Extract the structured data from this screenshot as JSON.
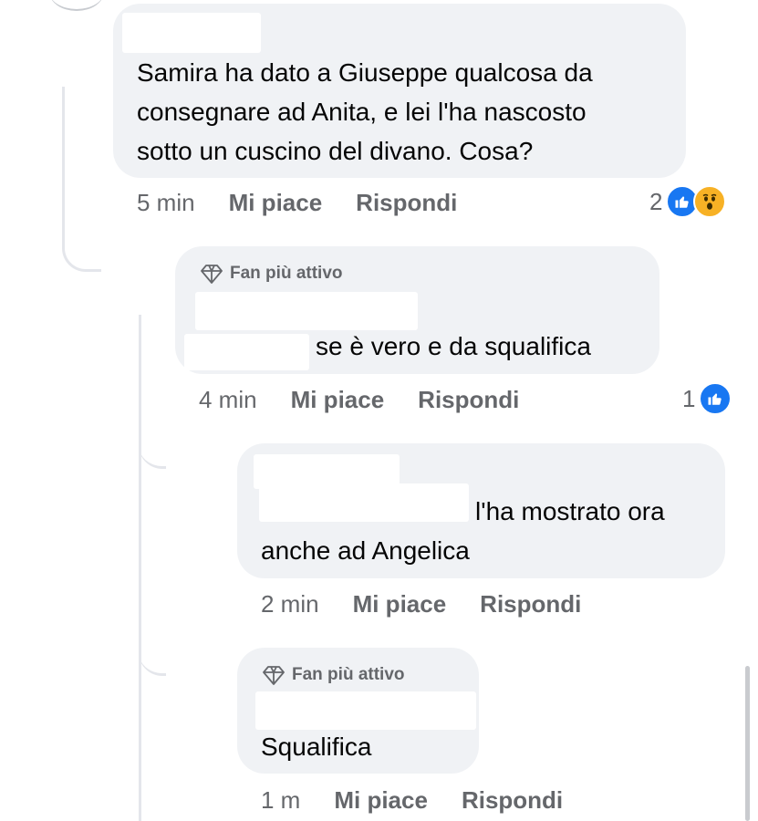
{
  "comments": [
    {
      "badge": "",
      "text_lines": [
        "Samira ha dato a Giuseppe qualcosa da",
        "consegnare ad Anita, e lei l'ha nascosto",
        "sotto un cuscino del divano. Cosa?"
      ],
      "time": "5 min",
      "like_label": "Mi piace",
      "reply_label": "Rispondi",
      "reaction_count": "2",
      "reactions": [
        "like-icon",
        "wow-icon"
      ]
    },
    {
      "badge": "Fan più attivo",
      "text_lines": [
        "se è vero e da squalifica"
      ],
      "time": "4 min",
      "like_label": "Mi piace",
      "reply_label": "Rispondi",
      "reaction_count": "1",
      "reactions": [
        "like-icon"
      ]
    },
    {
      "badge": "",
      "text_lines": [
        "l'ha mostrato ora",
        "anche ad Angelica"
      ],
      "time": "2 min",
      "like_label": "Mi piace",
      "reply_label": "Rispondi"
    },
    {
      "badge": "Fan più attivo",
      "text_lines": [
        "Squalifica"
      ],
      "time": "1 m",
      "like_label": "Mi piace",
      "reply_label": "Rispondi"
    }
  ],
  "colors": {
    "bubble": "#f0f2f5",
    "secondary_text": "#65676b",
    "like_blue": "#1877f2",
    "wow_yellow": "#f7b125"
  }
}
